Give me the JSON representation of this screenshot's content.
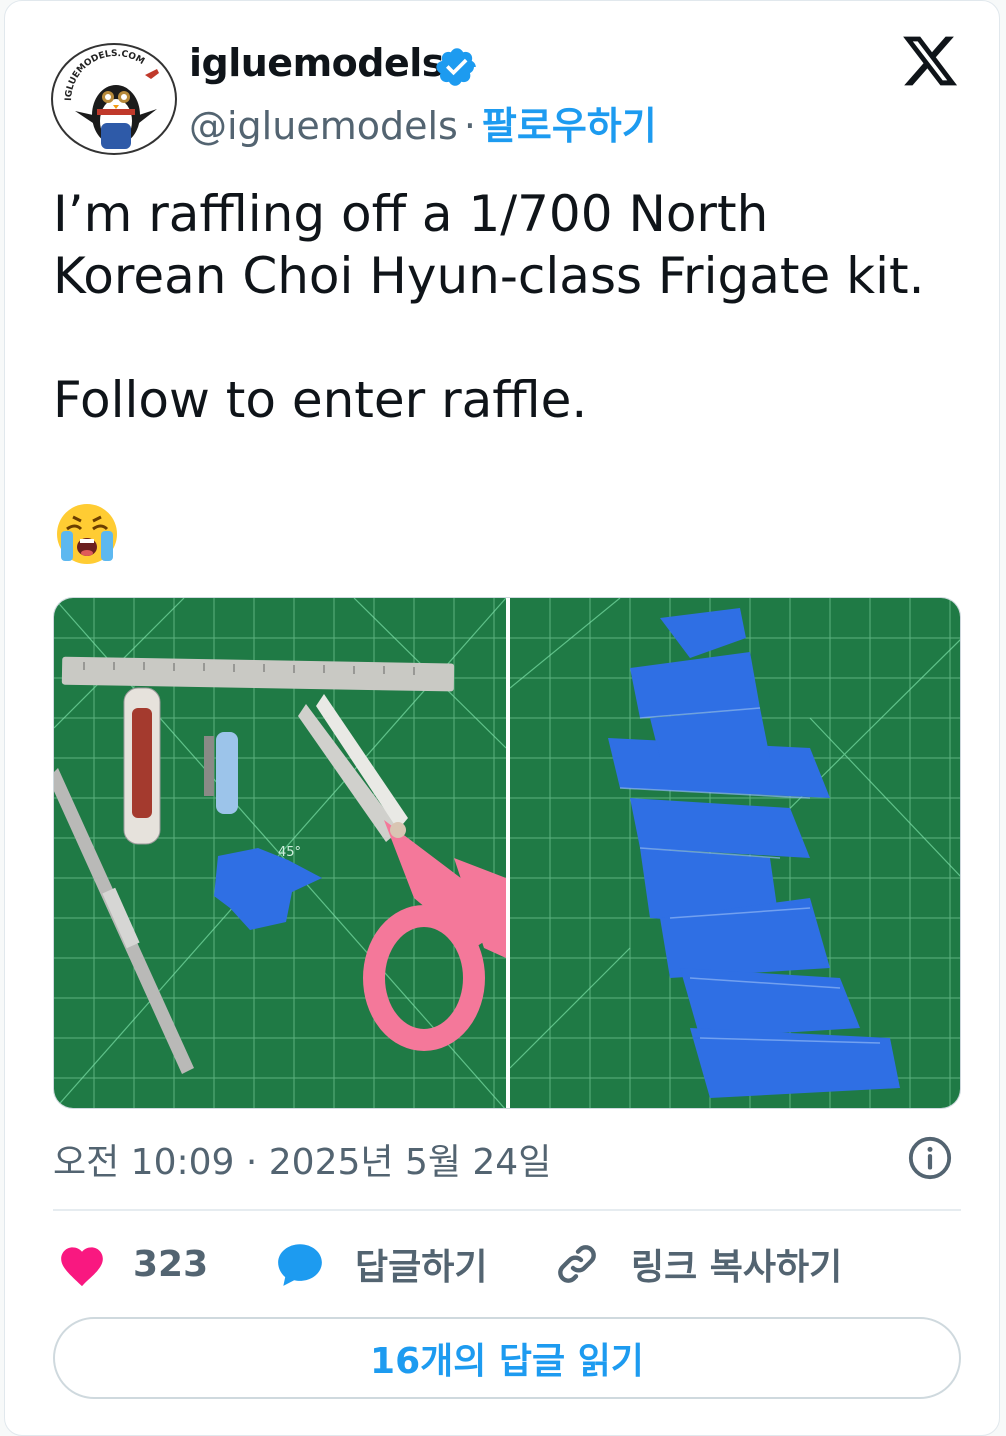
{
  "author": {
    "name": "igluemodels",
    "handle": "@igluemodels",
    "separator": "·",
    "follow_label": "팔로우하기",
    "avatar_logo_text": "IGLUEMODELS.COM"
  },
  "post": {
    "lines": [
      "I’m raffling off a 1/700 North",
      "Korean Choi Hyun-class Frigate kit.",
      "",
      "Follow to enter raffle."
    ],
    "emoji": "loudly-crying-face",
    "images": [
      {
        "name": "tools-on-cutting-mat",
        "mat_label": "45°"
      },
      {
        "name": "blue-tape-on-cutting-mat"
      }
    ]
  },
  "timestamp": "오전 10:09 · 2025년 5월 24일",
  "actions": {
    "likes": "323",
    "reply_label": "답글하기",
    "copy_link_label": "링크 복사하기"
  },
  "read_replies_label": "16개의 답글 읽기",
  "colors": {
    "accent": "#1d9bf0",
    "like": "#f91880",
    "text_primary": "#0f1419",
    "text_secondary": "#536471",
    "mat_green": "#1f7a45"
  }
}
